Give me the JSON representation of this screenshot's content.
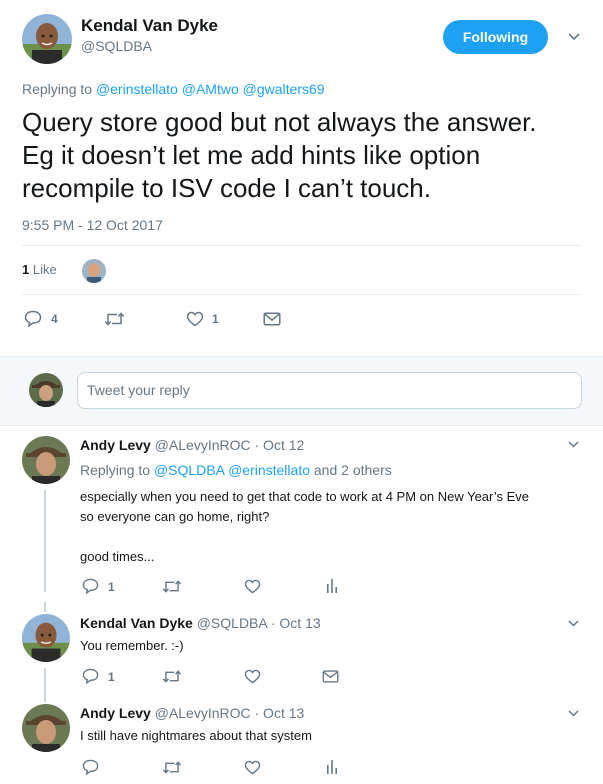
{
  "main_tweet": {
    "author_name": "Kendal Van Dyke",
    "author_handle": "@SQLDBA",
    "follow_button": "Following",
    "replying_prefix": "Replying to",
    "replying_mentions": [
      "@erinstellato",
      "@AMtwo",
      "@gwalters69"
    ],
    "text_lines": [
      "Query store good but not always the answer.",
      "Eg it doesn’t let me add hints like option",
      "recompile to ISV code I can’t touch."
    ],
    "timestamp": "9:55 PM - 12 Oct 2017",
    "likes_count": "1",
    "likes_label": "Like",
    "actions": {
      "reply_count": "4",
      "like_count": "1"
    }
  },
  "reply_box": {
    "placeholder": "Tweet your reply"
  },
  "replies": [
    {
      "author_name": "Andy Levy",
      "meta": "@ALevyInROC · Oct 12",
      "replying_prefix": "Replying to",
      "replying_mentions": [
        "@SQLDBA",
        "@erinstellato"
      ],
      "replying_suffix": "and 2 others",
      "text_lines": [
        "especially when you need to get that code to work at 4 PM on New Year’s Eve",
        "so everyone can go home, right?",
        "",
        "good times..."
      ],
      "reply_count": "1"
    },
    {
      "author_name": "Kendal Van Dyke",
      "meta": "@SQLDBA · Oct 13",
      "text": "You remember. :-)",
      "reply_count": "1"
    },
    {
      "author_name": "Andy Levy",
      "meta": "@ALevyInROC · Oct 13",
      "text": "I still have nightmares about that system"
    }
  ],
  "colors": {
    "accent": "#1da1f2",
    "gray_text": "#657786",
    "divider": "#e6ecf0",
    "reply_area_bg": "#f5f8fa",
    "thread_line": "#ccd6dd"
  }
}
